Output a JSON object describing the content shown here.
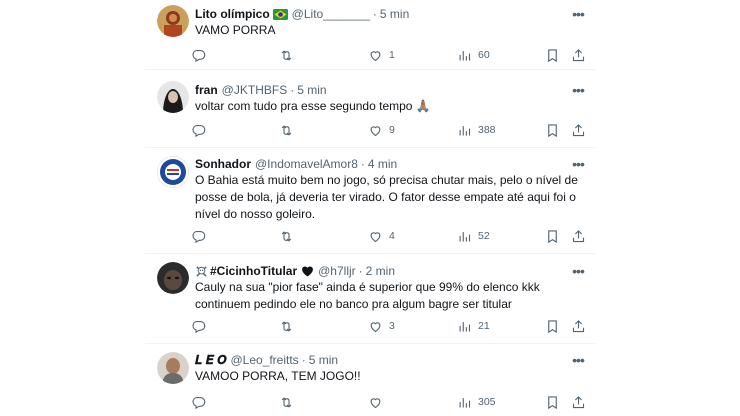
{
  "posts": [
    {
      "name": "Lito olímpico",
      "handle": "@Lito_______",
      "sep": "·",
      "time": "5 min",
      "text": "VAMO PORRA",
      "replies": "",
      "retweets": "",
      "likes": "1",
      "views": "60"
    },
    {
      "name": "fran",
      "handle": "@JKTHBFS",
      "sep": "·",
      "time": "5 min",
      "text": "voltar com tudo pra esse segundo tempo 🙏🏽",
      "replies": "",
      "retweets": "",
      "likes": "9",
      "views": "388"
    },
    {
      "name": "Sonhador",
      "handle": "@IndomavelAmor8",
      "sep": "·",
      "time": "4 min",
      "text": "O Bahia está muito bem no jogo, só precisa chutar mais, pelo o nível de posse de bola, já deveria ter virado. O fator desse empate até aqui foi o nível do nosso goleiro.",
      "replies": "",
      "retweets": "",
      "likes": "4",
      "views": "52"
    },
    {
      "name": "#CicinhoTitular",
      "handle": "@h7lljr",
      "sep": "·",
      "time": "2 min",
      "text": "Cauly na sua \"pior fase\" ainda é superior que 99% do elenco kkk continuem pedindo ele no banco pra algum bagre ser titular",
      "replies": "",
      "retweets": "",
      "likes": "3",
      "views": "21"
    },
    {
      "name": "𝑳 𝑬 𝑶",
      "handle": "@Leo_freitts",
      "sep": "·",
      "time": "5 min",
      "text": "VAMOO PORRA, TEM JOGO!!",
      "replies": "",
      "retweets": "",
      "likes": "",
      "views": "305"
    }
  ],
  "icons": {
    "more": "more-icon",
    "reply": "reply-icon",
    "retweet": "retweet-icon",
    "like": "heart-icon",
    "views": "views-icon",
    "bookmark": "bookmark-icon",
    "share": "share-icon"
  },
  "colors": {
    "text": "#0f1419",
    "secondary": "#536471",
    "divider": "#eff3f4"
  }
}
